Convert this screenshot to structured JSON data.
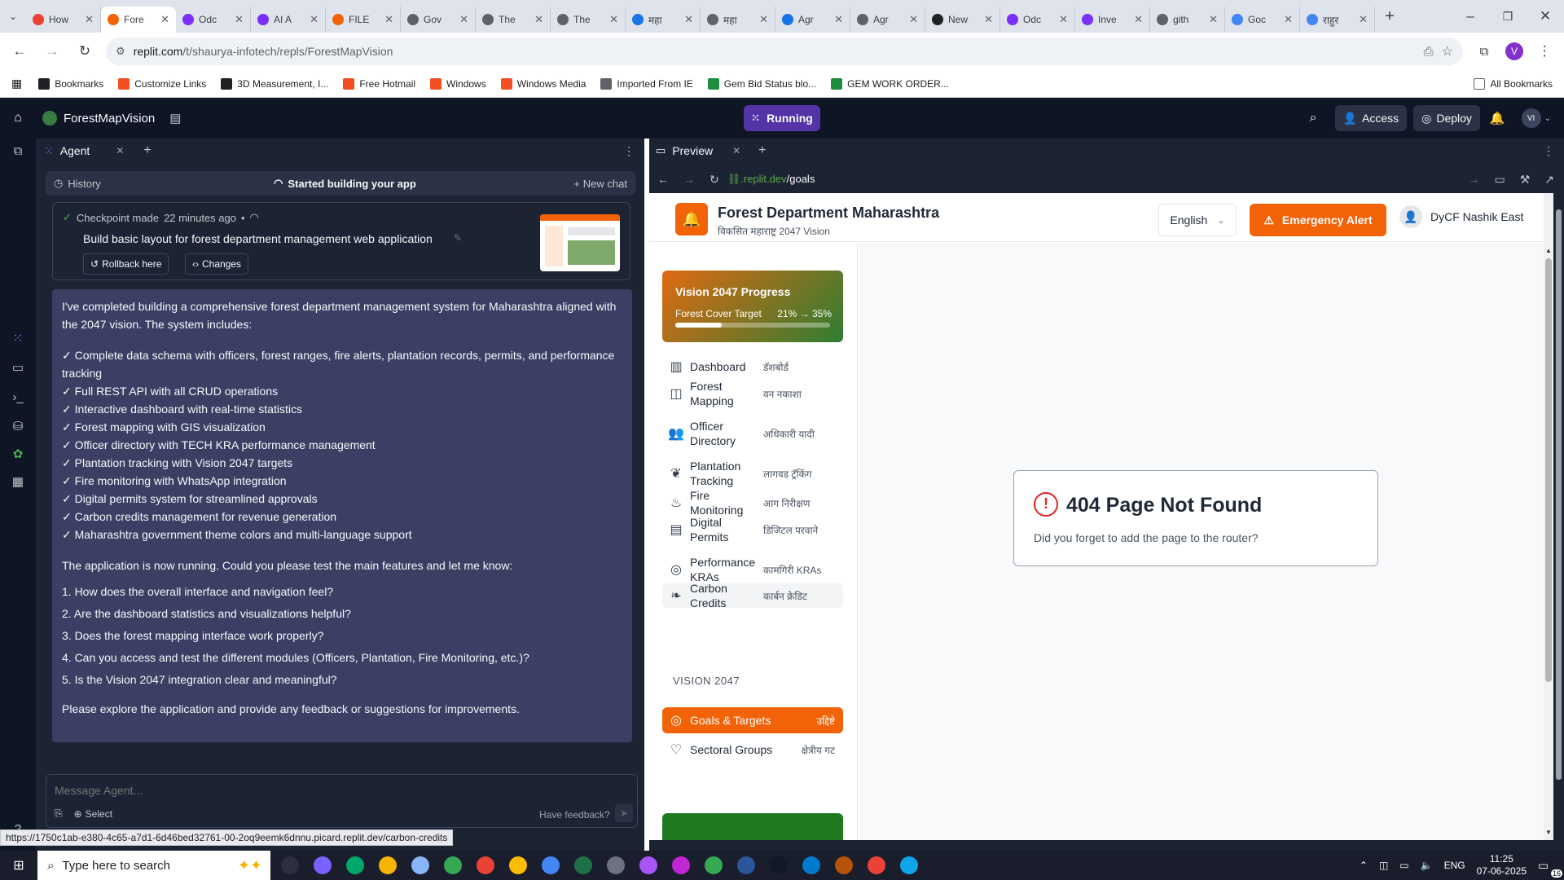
{
  "browser": {
    "tabs": [
      {
        "title": "How",
        "icon_color": "#ea4335",
        "icon": "gmail-icon"
      },
      {
        "title": "Fore",
        "icon_color": "#f26207",
        "icon": "replit-icon",
        "active": true
      },
      {
        "title": "Odc",
        "icon_color": "#7b2ff7",
        "icon": "odoo-icon"
      },
      {
        "title": "AI A",
        "icon_color": "#7b2ff7",
        "icon": "odoo-icon"
      },
      {
        "title": "FILE",
        "icon_color": "#f26207",
        "icon": "file-icon"
      },
      {
        "title": "Gov",
        "icon_color": "#5f6368",
        "icon": "globe-icon"
      },
      {
        "title": "The",
        "icon_color": "#5f6368",
        "icon": "globe-icon"
      },
      {
        "title": "The",
        "icon_color": "#5f6368",
        "icon": "globe-icon"
      },
      {
        "title": "महा",
        "icon_color": "#1a73e8",
        "icon": "docs-icon"
      },
      {
        "title": "महा",
        "icon_color": "#5f6368",
        "icon": "globe-icon"
      },
      {
        "title": "Agr",
        "icon_color": "#1a73e8",
        "icon": "docs-icon"
      },
      {
        "title": "Agr",
        "icon_color": "#5f6368",
        "icon": "globe-icon"
      },
      {
        "title": "New",
        "icon_color": "#202124",
        "icon": "openai-icon"
      },
      {
        "title": "Odc",
        "icon_color": "#7b2ff7",
        "icon": "odoo-icon"
      },
      {
        "title": "Inve",
        "icon_color": "#7b2ff7",
        "icon": "odoo-icon"
      },
      {
        "title": "gith",
        "icon_color": "#5f6368",
        "icon": "globe-icon"
      },
      {
        "title": "Goc",
        "icon_color": "#4285f4",
        "icon": "gemini-icon"
      },
      {
        "title": "राहुर",
        "icon_color": "#4285f4",
        "icon": "google-icon"
      }
    ],
    "url_host": "replit.com",
    "url_path": "/t/shaurya-infotech/repls/ForestMapVision",
    "profile_initial": "V",
    "bookmarks": [
      {
        "label": "Bookmarks",
        "icon": "star-icon"
      },
      {
        "label": "Customize Links",
        "icon": "windows-icon"
      },
      {
        "label": "3D Measurement, I...",
        "icon": "globe-icon"
      },
      {
        "label": "Free Hotmail",
        "icon": "windows-icon"
      },
      {
        "label": "Windows",
        "icon": "windows-icon"
      },
      {
        "label": "Windows Media",
        "icon": "windows-icon"
      },
      {
        "label": "Imported From IE",
        "icon": "folder-icon"
      },
      {
        "label": "Gem Bid Status blo...",
        "icon": "gem-icon"
      },
      {
        "label": "GEM WORK ORDER...",
        "icon": "gem-icon"
      }
    ],
    "all_bookmarks": "All Bookmarks"
  },
  "replit": {
    "repl_name": "ForestMapVision",
    "run_label": "Running",
    "access_label": "Access",
    "deploy_label": "Deploy",
    "avatar_initials": "VI",
    "agent_tab": "Agent",
    "preview_tab": "Preview",
    "history_label": "History",
    "chat_title": "Started building your app",
    "new_chat_label": "New chat",
    "checkpoint_text": "Checkpoint made",
    "checkpoint_time": "22 minutes ago",
    "checkpoint_title": "Build basic layout for forest department management web application",
    "rollback_label": "Rollback here",
    "changes_label": "Changes",
    "message_intro": "I've completed building a comprehensive forest department management system for Maharashtra aligned with the 2047 vision. The system includes:",
    "features": [
      "✓ Complete data schema with officers, forest ranges, fire alerts, plantation records, permits, and performance tracking",
      "✓ Full REST API with all CRUD operations",
      "✓ Interactive dashboard with real-time statistics",
      "✓ Forest mapping with GIS visualization",
      "✓ Officer directory with TECH KRA performance management",
      "✓ Plantation tracking with Vision 2047 targets",
      "✓ Fire monitoring with WhatsApp integration",
      "✓ Digital permits system for streamlined approvals",
      "✓ Carbon credits management for revenue generation",
      "✓ Maharashtra government theme colors and multi-language support"
    ],
    "question_intro": "The application is now running. Could you please test the main features and let me know:",
    "questions": [
      "1. How does the overall interface and navigation feel?",
      "2. Are the dashboard statistics and visualizations helpful?",
      "3. Does the forest mapping interface work properly?",
      "4. Can you access and test the different modules (Officers, Plantation, Fire Monitoring, etc.)?",
      "5. Is the Vision 2047 integration clear and meaningful?"
    ],
    "closing": "Please explore the application and provide any feedback or suggestions for improvements.",
    "message_placeholder": "Message Agent...",
    "select_label": "Select",
    "feedback_label": "Have feedback?",
    "preview_url_host": ".replit.dev",
    "preview_url_path": "/goals",
    "status_link": "https://1750c1ab-e380-4c65-a7d1-6d46bed32761-00-2oq9eemk6dnnu.picard.replit.dev/carbon-credits"
  },
  "app": {
    "org_title": "Forest Department Maharashtra",
    "org_subtitle": "विकसित महाराष्ट्र 2047 Vision",
    "language": "English",
    "emergency_label": "Emergency Alert",
    "user_name": "DyCF Nashik East",
    "vision_card": {
      "title": "Vision 2047 Progress",
      "label": "Forest Cover Target",
      "value": "21% → 35%",
      "progress": 0.3
    },
    "nav": [
      {
        "label": "Dashboard",
        "hindi": "डॅशबोर्ड",
        "icon": "chart-icon"
      },
      {
        "label": "Forest Mapping",
        "hindi": "वन नकाशा",
        "icon": "map-icon"
      },
      {
        "label": "Officer Directory",
        "hindi": "अधिकारी यादी",
        "icon": "users-icon"
      },
      {
        "label": "Plantation Tracking",
        "hindi": "लागवड ट्रॅकिंग",
        "icon": "sprout-icon"
      },
      {
        "label": "Fire Monitoring",
        "hindi": "आग निरीक्षण",
        "icon": "flame-icon"
      },
      {
        "label": "Digital Permits",
        "hindi": "डिजिटल परवाने",
        "icon": "document-icon"
      },
      {
        "label": "Performance KRAs",
        "hindi": "कामगिरी KRAs",
        "icon": "target-icon"
      },
      {
        "label": "Carbon Credits",
        "hindi": "कार्बन क्रेडिट",
        "icon": "leaf-icon"
      }
    ],
    "section_label": "VISION 2047",
    "vision_nav": [
      {
        "label": "Goals & Targets",
        "hindi": "उद्दिष्टे",
        "icon": "target-icon",
        "active": true
      },
      {
        "label": "Sectoral Groups",
        "hindi": "क्षेत्रीय गट",
        "icon": "handshake-icon"
      }
    ],
    "error_title": "404 Page Not Found",
    "error_message": "Did you forget to add the page to the router?",
    "colors": {
      "primary": "#f26207",
      "sidebar_active": "#f26207",
      "emergency": "#f26207",
      "error": "#dc2626"
    }
  },
  "taskbar": {
    "search_placeholder": "Type here to search",
    "language": "ENG",
    "time": "11:25",
    "date": "07-06-2025",
    "notifications": "16"
  }
}
